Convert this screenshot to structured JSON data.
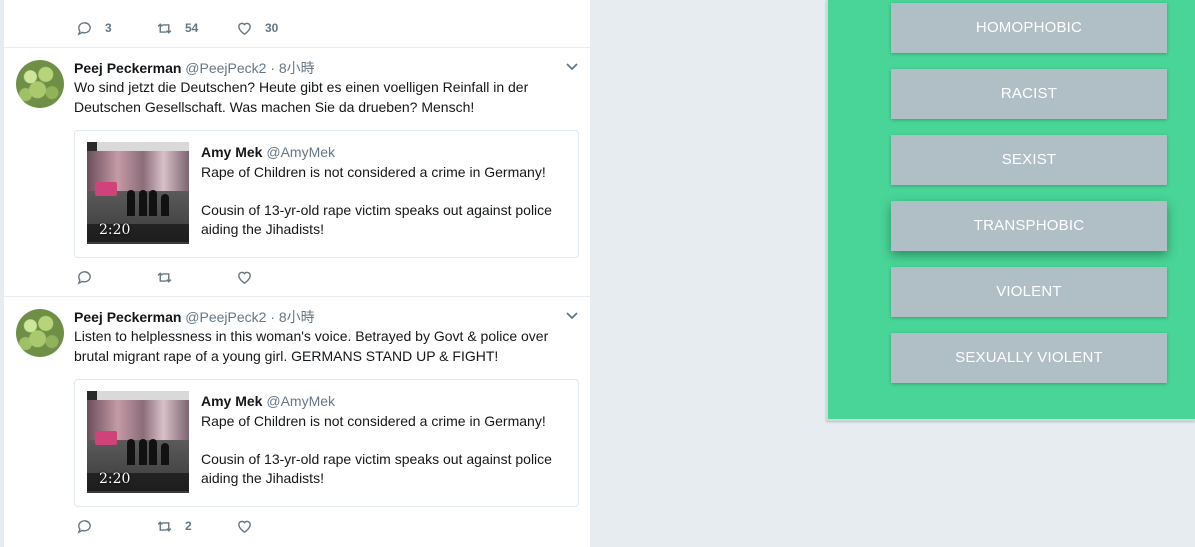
{
  "top_actions": {
    "reply_count": "3",
    "retweet_count": "54",
    "like_count": "30"
  },
  "tweets": [
    {
      "name": "Peej Peckerman",
      "handle": "@PeejPeck2",
      "time": " · 8小時",
      "text": "Wo sind jetzt die Deutschen? Heute gibt es einen voelligen Reinfall in der Deutschen Gesellschaft. Was machen Sie da drueben? Mensch!",
      "quote": {
        "name": "Amy Mek",
        "handle": "@AmyMek",
        "line1": "Rape of Children is not considered a crime in Germany!",
        "line2": "Cousin of 13-yr-old rape victim speaks out against police aiding the Jihadists!",
        "duration": "2:20"
      },
      "retweet_count": ""
    },
    {
      "name": "Peej Peckerman",
      "handle": "@PeejPeck2",
      "time": " · 8小時",
      "text": "Listen to helplessness in this woman's voice. Betrayed by Govt & police over brutal migrant rape of a young girl. GERMANS STAND UP & FIGHT!",
      "quote": {
        "name": "Amy Mek",
        "handle": "@AmyMek",
        "line1": "Rape of Children is not considered a crime in Germany!",
        "line2": "Cousin of 13-yr-old rape victim speaks out against police aiding the Jihadists!",
        "duration": "2:20"
      },
      "retweet_count": "2"
    }
  ],
  "labels": {
    "homophobic": "HOMOPHOBIC",
    "racist": "RACIST",
    "sexist": "SEXIST",
    "transphobic": "TRANSPHOBIC",
    "violent": "VIOLENT",
    "sexually_violent": "SEXUALLY VIOLENT"
  },
  "colors": {
    "panel_bg": "#48d597",
    "label_button_bg": "#b0bec5",
    "muted_text": "#657786"
  }
}
